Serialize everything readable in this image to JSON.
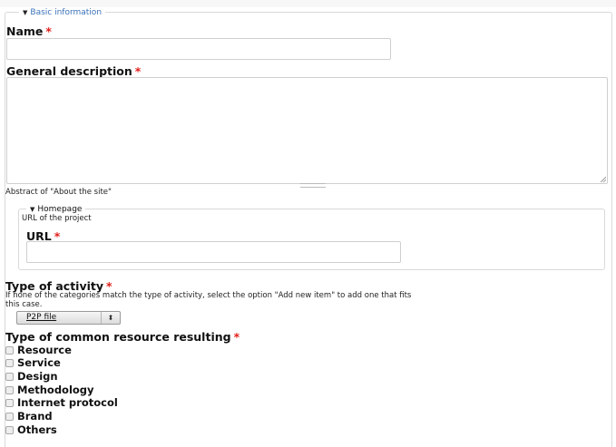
{
  "basic_information": {
    "legend": "Basic information",
    "name": {
      "label": "Name",
      "required_mark": "*",
      "value": ""
    },
    "general_description": {
      "label": "General description",
      "required_mark": "*",
      "value": "",
      "help": "Abstract of \"About the site\""
    }
  },
  "homepage": {
    "legend": "Homepage",
    "description": "URL of the project",
    "url": {
      "label": "URL",
      "required_mark": "*",
      "value": ""
    }
  },
  "type_of_activity": {
    "label": "Type of activity",
    "required_mark": "*",
    "help_line1": "If none of the categories match the type of activity, select the option \"Add new item\" to add one that fits",
    "help_line2": "this case.",
    "selected": "P2P file"
  },
  "resource_type": {
    "label": "Type of common resource resulting",
    "required_mark": "*",
    "options": [
      "Resource",
      "Service",
      "Design",
      "Methodology",
      "Internet protocol",
      "Brand",
      "Others"
    ]
  },
  "icons": {
    "collapse": "triangle-down-icon",
    "select_arrows": "up-down-arrow-icon",
    "resize": "resize-grip-icon"
  },
  "colors": {
    "required": "#e0201b",
    "legend_link": "#3a71b8",
    "border": "#cfcfcf"
  }
}
